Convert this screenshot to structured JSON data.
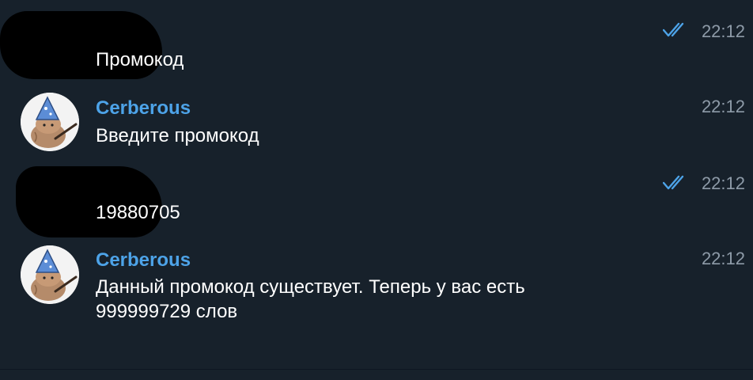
{
  "messages": [
    {
      "type": "outgoing",
      "text": "Промокод",
      "time": "22:12",
      "read_status": "double-check-icon"
    },
    {
      "type": "incoming",
      "sender": "Cerberous",
      "text": "Введите промокод",
      "time": "22:12"
    },
    {
      "type": "outgoing",
      "text": "19880705",
      "time": "22:12",
      "read_status": "double-check-icon"
    },
    {
      "type": "incoming",
      "sender": "Cerberous",
      "text": "Данный промокод существует. Теперь у вас есть\n999999729 слов",
      "time": "22:12"
    }
  ],
  "colors": {
    "background": "#17212b",
    "sender_name": "#4da3e8",
    "timestamp": "#8e9ba8",
    "read_check": "#4da3e8"
  }
}
